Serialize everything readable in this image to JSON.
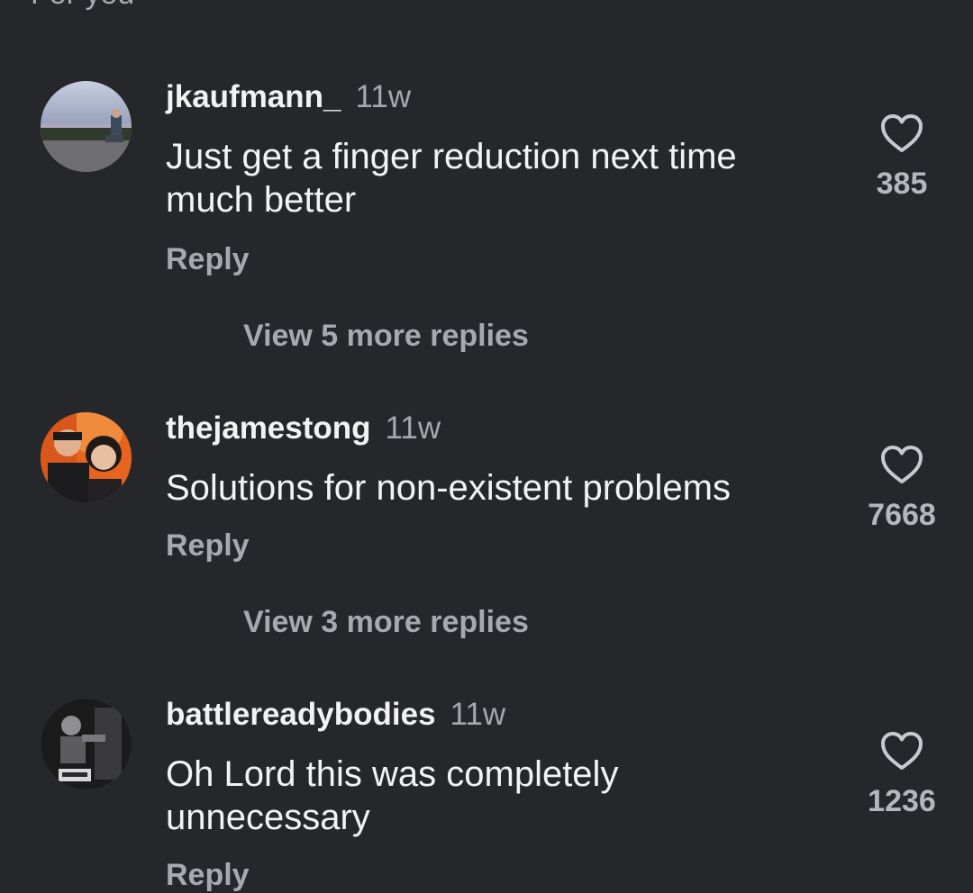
{
  "header": {
    "partial_label": "For you"
  },
  "comments": [
    {
      "username": "jkaufmann_",
      "time": "11w",
      "text": "Just get a finger reduction next time much better",
      "reply_label": "Reply",
      "likes": "385",
      "view_more": "View 5 more replies",
      "avatar": "landscape-with-person"
    },
    {
      "username": "thejamestong",
      "time": "11w",
      "text": "Solutions for non-existent problems",
      "reply_label": "Reply",
      "likes": "7668",
      "view_more": "View 3 more replies",
      "avatar": "couple-selfie-orange"
    },
    {
      "username": "battlereadybodies",
      "time": "11w",
      "text": "Oh Lord this was completely unnecessary",
      "reply_label": "Reply",
      "likes": "1236",
      "avatar": "boxing-gym-bw"
    }
  ],
  "colors": {
    "background": "#26272b",
    "primary_text": "#f3f3f4",
    "secondary_text": "#a7a9af"
  }
}
